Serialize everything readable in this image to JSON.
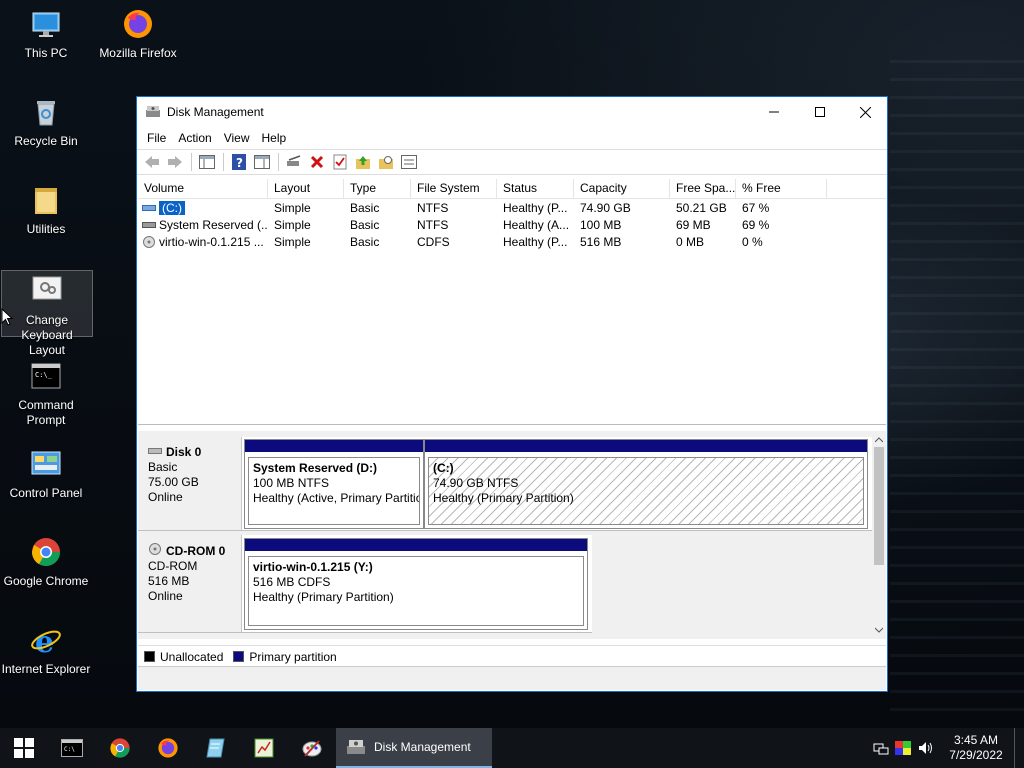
{
  "desktop": {
    "icons": [
      {
        "label": "This PC",
        "icon": "monitor-icon"
      },
      {
        "label": "Mozilla Firefox",
        "icon": "firefox-icon"
      },
      {
        "label": "Recycle Bin",
        "icon": "recycle-bin-icon"
      },
      {
        "label": "Utilities",
        "icon": "folder-icon"
      },
      {
        "label": "Change Keyboard Layout",
        "icon": "keyboard-settings-icon"
      },
      {
        "label": "Command Prompt",
        "icon": "cmd-icon"
      },
      {
        "label": "Control Panel",
        "icon": "control-panel-icon"
      },
      {
        "label": "Google Chrome",
        "icon": "chrome-icon"
      },
      {
        "label": "Internet Explorer",
        "icon": "ie-icon"
      }
    ]
  },
  "window": {
    "title": "Disk Management",
    "menu": [
      "File",
      "Action",
      "View",
      "Help"
    ],
    "columns": [
      "Volume",
      "Layout",
      "Type",
      "File System",
      "Status",
      "Capacity",
      "Free Spa...",
      "% Free"
    ],
    "volumes": [
      {
        "volume": "(C:)",
        "layout": "Simple",
        "type": "Basic",
        "fs": "NTFS",
        "status": "Healthy (P...",
        "capacity": "74.90 GB",
        "free": "50.21 GB",
        "pct": "67 %"
      },
      {
        "volume": "System Reserved (...",
        "layout": "Simple",
        "type": "Basic",
        "fs": "NTFS",
        "status": "Healthy (A...",
        "capacity": "100 MB",
        "free": "69 MB",
        "pct": "69 %"
      },
      {
        "volume": "virtio-win-0.1.215 ...",
        "layout": "Simple",
        "type": "Basic",
        "fs": "CDFS",
        "status": "Healthy (P...",
        "capacity": "516 MB",
        "free": "0 MB",
        "pct": "0 %"
      }
    ],
    "disks": [
      {
        "name": "Disk 0",
        "type": "Basic",
        "size": "75.00 GB",
        "state": "Online",
        "partitions": [
          {
            "title": "System Reserved  (D:)",
            "line2": "100 MB NTFS",
            "line3": "Healthy (Active, Primary Partitio"
          },
          {
            "title": "(C:)",
            "line2": "74.90 GB NTFS",
            "line3": "Healthy (Primary Partition)"
          }
        ]
      },
      {
        "name": "CD-ROM 0",
        "type": "CD-ROM",
        "size": "516 MB",
        "state": "Online",
        "partitions": [
          {
            "title": "virtio-win-0.1.215  (Y:)",
            "line2": "516 MB CDFS",
            "line3": "Healthy (Primary Partition)"
          }
        ]
      }
    ],
    "legend": [
      {
        "label": "Unallocated",
        "color": "#000000"
      },
      {
        "label": "Primary partition",
        "color": "#0b0b7e"
      }
    ]
  },
  "taskbar": {
    "active_app": "Disk Management",
    "time": "3:45 AM",
    "date": "7/29/2022"
  }
}
